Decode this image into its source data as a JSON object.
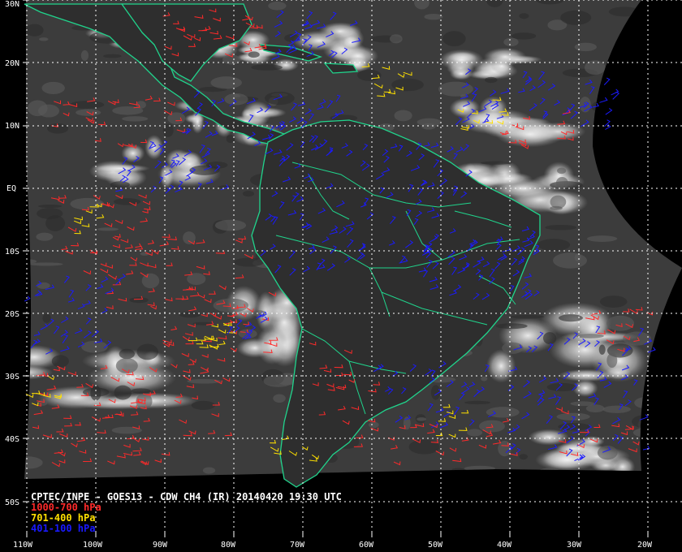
{
  "title": "CPTEC/INPE - GOES13 - CDW CH4 (IR) 20140420 19:30 UTC",
  "legend": [
    {
      "label": "1000-700 hPa",
      "color": "#ff2a2a"
    },
    {
      "label": "701-400 hPa",
      "color": "#ffe000"
    },
    {
      "label": "401-100 hPa",
      "color": "#1a1aff"
    }
  ],
  "lat_labels": [
    "30N",
    "20N",
    "10N",
    "EQ",
    "10S",
    "20S",
    "30S",
    "40S",
    "50S"
  ],
  "lon_labels": [
    "110W",
    "100W",
    "90W",
    "80W",
    "70W",
    "60W",
    "50W",
    "40W",
    "30W",
    "20W"
  ],
  "colors": {
    "coastline": "#20d48c",
    "grid": "#ffffff",
    "background": "#000000",
    "ocean": "#3c3c3c"
  }
}
